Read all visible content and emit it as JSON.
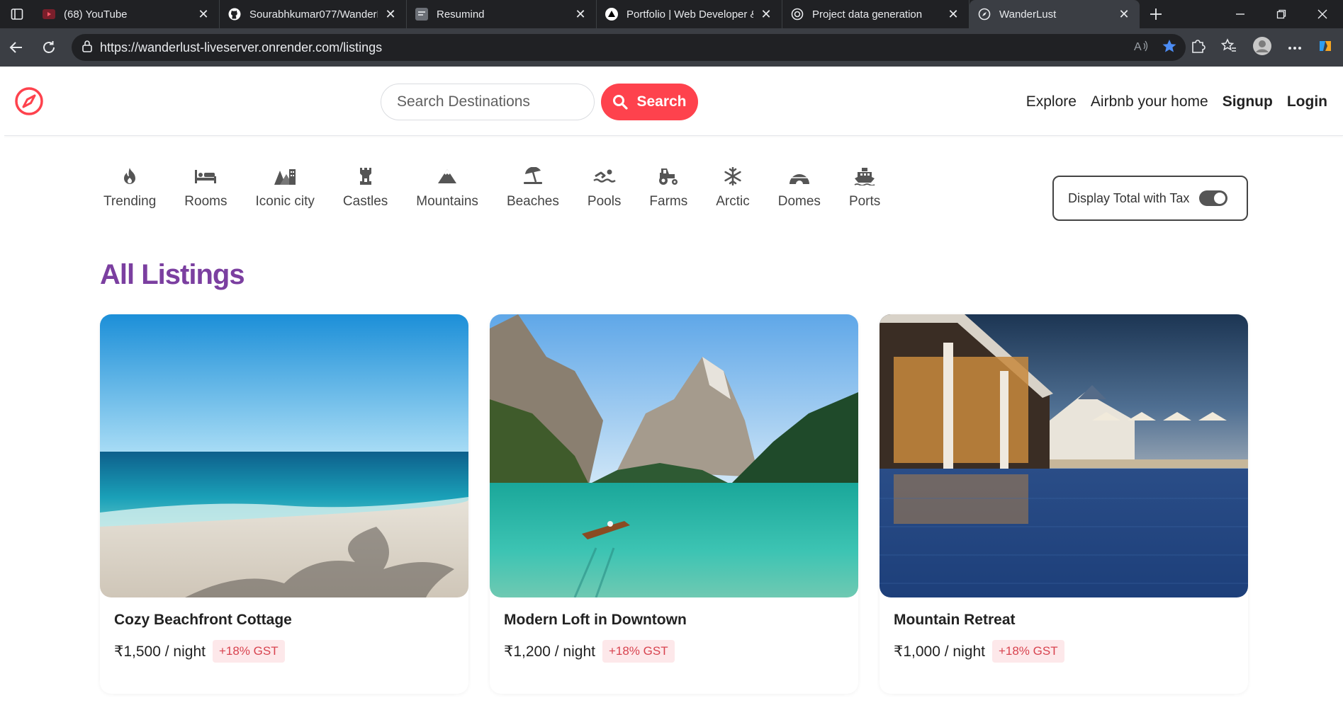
{
  "browser": {
    "tabs": [
      {
        "title": "(68) YouTube",
        "favicon": "youtube-icon",
        "color": "#ff0033"
      },
      {
        "title": "Sourabhkumar077/WanderLust",
        "favicon": "github-icon",
        "color": "#ffffff"
      },
      {
        "title": "Resumind",
        "favicon": "resumind-icon",
        "color": "#9aa0a6"
      },
      {
        "title": "Portfolio | Web Developer & Designer",
        "favicon": "triangle-logo-icon",
        "color": "#ffffff"
      },
      {
        "title": "Project data generation",
        "favicon": "openai-icon",
        "color": "#ffffff"
      },
      {
        "title": "WanderLust",
        "favicon": "compass-icon",
        "color": "#ffffff"
      }
    ],
    "url": "https://wanderlust-liveserver.onrender.com/listings"
  },
  "site": {
    "search_placeholder": "Search Destinations",
    "search_button": "Search",
    "nav": {
      "explore": "Explore",
      "host": "Airbnb your home",
      "signup": "Signup",
      "login": "Login"
    },
    "accent": "#fe424d",
    "title_color": "#7b3fa0"
  },
  "filters": [
    {
      "label": "Trending",
      "icon": "fire-icon"
    },
    {
      "label": "Rooms",
      "icon": "bed-icon"
    },
    {
      "label": "Iconic city",
      "icon": "city-icon"
    },
    {
      "label": "Castles",
      "icon": "castle-icon"
    },
    {
      "label": "Mountains",
      "icon": "mountain-icon"
    },
    {
      "label": "Beaches",
      "icon": "umbrella-beach-icon"
    },
    {
      "label": "Pools",
      "icon": "swimmer-icon"
    },
    {
      "label": "Farms",
      "icon": "tractor-icon"
    },
    {
      "label": "Arctic",
      "icon": "snowflake-icon"
    },
    {
      "label": "Domes",
      "icon": "igloo-icon"
    },
    {
      "label": "Ports",
      "icon": "ship-icon"
    }
  ],
  "tax_toggle": {
    "label": "Display Total with Tax",
    "on": true
  },
  "page_title": "All Listings",
  "listings": [
    {
      "title": "Cozy Beachfront Cottage",
      "price": "₹1,500 / night",
      "gst": "+18% GST"
    },
    {
      "title": "Modern Loft in Downtown",
      "price": "₹1,200 / night",
      "gst": "+18% GST"
    },
    {
      "title": "Mountain Retreat",
      "price": "₹1,000 / night",
      "gst": "+18% GST"
    }
  ]
}
